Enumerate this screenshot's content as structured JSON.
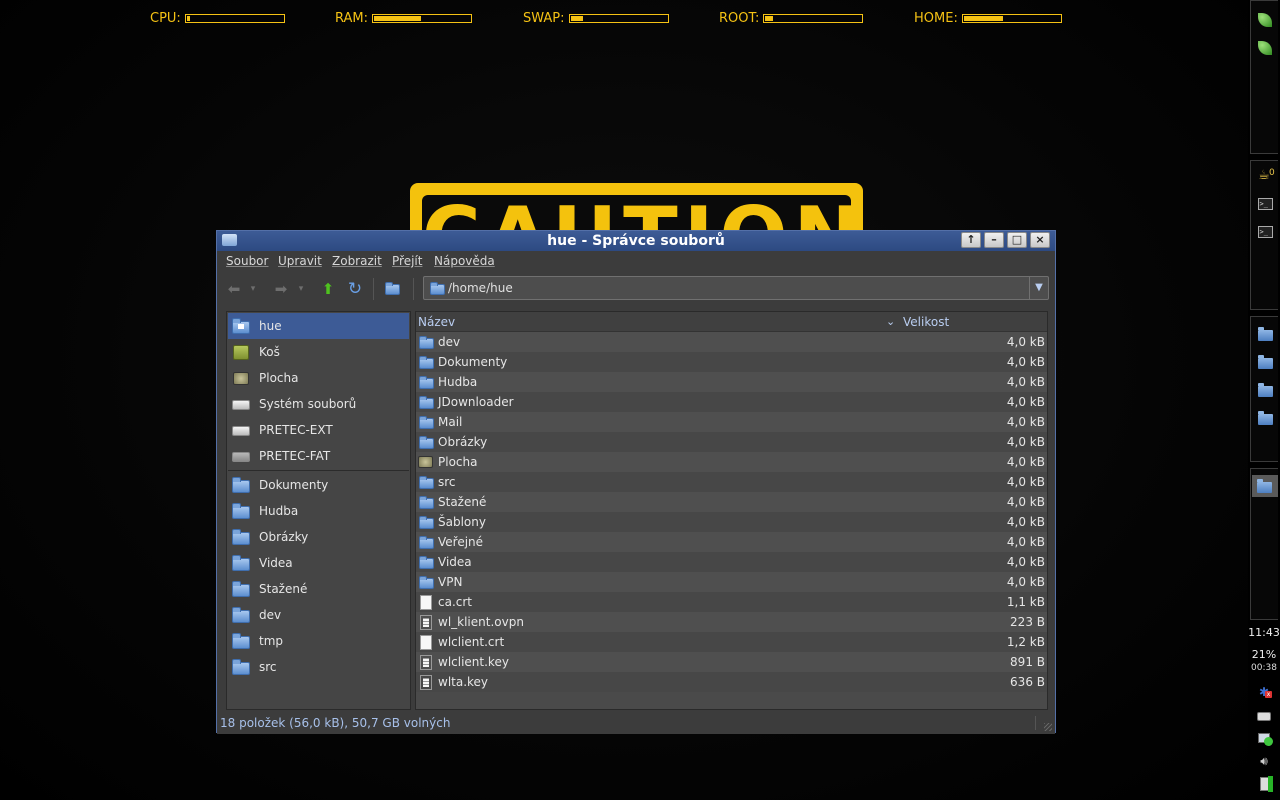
{
  "meters": [
    {
      "label": "CPU:",
      "value": 0.02
    },
    {
      "label": "RAM:",
      "value": 0.48
    },
    {
      "label": "SWAP:",
      "value": 0.12
    },
    {
      "label": "ROOT:",
      "value": 0.08
    },
    {
      "label": "HOME:",
      "value": 0.4
    }
  ],
  "wallpaper": {
    "caution_text": "CAUTION"
  },
  "window": {
    "title": "hue - Správce souborů",
    "buttons": {
      "up": "↑",
      "minimize": "–",
      "maximize": "□",
      "close": "×"
    }
  },
  "menu": [
    "Soubor",
    "Upravit",
    "Zobrazit",
    "Přejít",
    "Nápověda"
  ],
  "location": {
    "path": "/home/hue"
  },
  "sidebar": {
    "places": [
      {
        "label": "hue",
        "icon": "home-folder-icon",
        "selected": true
      },
      {
        "label": "Koš",
        "icon": "trash-icon"
      },
      {
        "label": "Plocha",
        "icon": "desktop-icon"
      },
      {
        "label": "Systém souborů",
        "icon": "drive-icon"
      },
      {
        "label": "PRETEC-EXT",
        "icon": "drive-icon"
      },
      {
        "label": "PRETEC-FAT",
        "icon": "drive-icon"
      }
    ],
    "bookmarks": [
      {
        "label": "Dokumenty"
      },
      {
        "label": "Hudba"
      },
      {
        "label": "Obrázky"
      },
      {
        "label": "Videa"
      },
      {
        "label": "Stažené"
      },
      {
        "label": "dev"
      },
      {
        "label": "tmp"
      },
      {
        "label": "src"
      }
    ]
  },
  "file_list": {
    "columns": {
      "name": "Název",
      "size": "Velikost"
    },
    "files": [
      {
        "name": "dev",
        "size": "4,0 kB",
        "type": "folder"
      },
      {
        "name": "Dokumenty",
        "size": "4,0 kB",
        "type": "folder"
      },
      {
        "name": "Hudba",
        "size": "4,0 kB",
        "type": "folder"
      },
      {
        "name": "JDownloader",
        "size": "4,0 kB",
        "type": "folder"
      },
      {
        "name": "Mail",
        "size": "4,0 kB",
        "type": "folder"
      },
      {
        "name": "Obrázky",
        "size": "4,0 kB",
        "type": "folder"
      },
      {
        "name": "Plocha",
        "size": "4,0 kB",
        "type": "desktop"
      },
      {
        "name": "src",
        "size": "4,0 kB",
        "type": "folder"
      },
      {
        "name": "Stažené",
        "size": "4,0 kB",
        "type": "folder"
      },
      {
        "name": "Šablony",
        "size": "4,0 kB",
        "type": "folder"
      },
      {
        "name": "Veřejné",
        "size": "4,0 kB",
        "type": "folder"
      },
      {
        "name": "Videa",
        "size": "4,0 kB",
        "type": "folder"
      },
      {
        "name": "VPN",
        "size": "4,0 kB",
        "type": "folder"
      },
      {
        "name": "ca.crt",
        "size": "1,1 kB",
        "type": "file"
      },
      {
        "name": "wl_klient.ovpn",
        "size": "223 B",
        "type": "text"
      },
      {
        "name": "wlclient.crt",
        "size": "1,2 kB",
        "type": "file"
      },
      {
        "name": "wlclient.key",
        "size": "891 B",
        "type": "text"
      },
      {
        "name": "wlta.key",
        "size": "636 B",
        "type": "text"
      }
    ]
  },
  "status": {
    "text": "18 položek (56,0 kB), 50,7 GB volných"
  },
  "panel": {
    "clock": "11:43",
    "battery_percent": "21%",
    "battery_time": "00:38",
    "badge": "0"
  },
  "colors": {
    "accent": "#3d5b96",
    "meter": "#f5c214"
  }
}
